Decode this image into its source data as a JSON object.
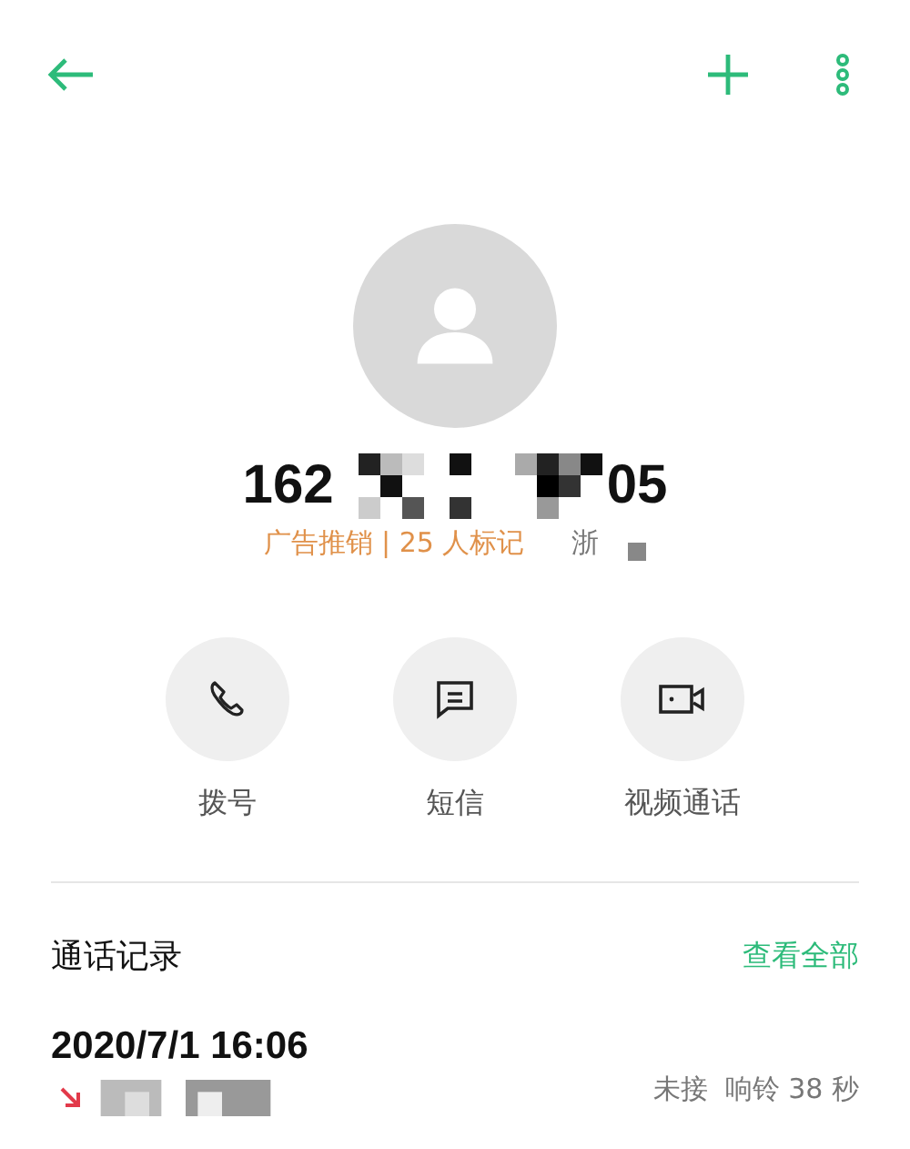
{
  "contact": {
    "number_start": "162",
    "number_end": "05",
    "tag": "广告推销 | 25 人标记",
    "location": "浙"
  },
  "actions": [
    {
      "kind": "call",
      "label": "拨号"
    },
    {
      "kind": "message",
      "label": "短信"
    },
    {
      "kind": "video",
      "label": "视频通话"
    }
  ],
  "call_log": {
    "title": "通话记录",
    "view_all": "查看全部",
    "entries": [
      {
        "time": "2020/7/1 16:06",
        "status": "未接  响铃 38 秒",
        "missed": true
      }
    ]
  }
}
